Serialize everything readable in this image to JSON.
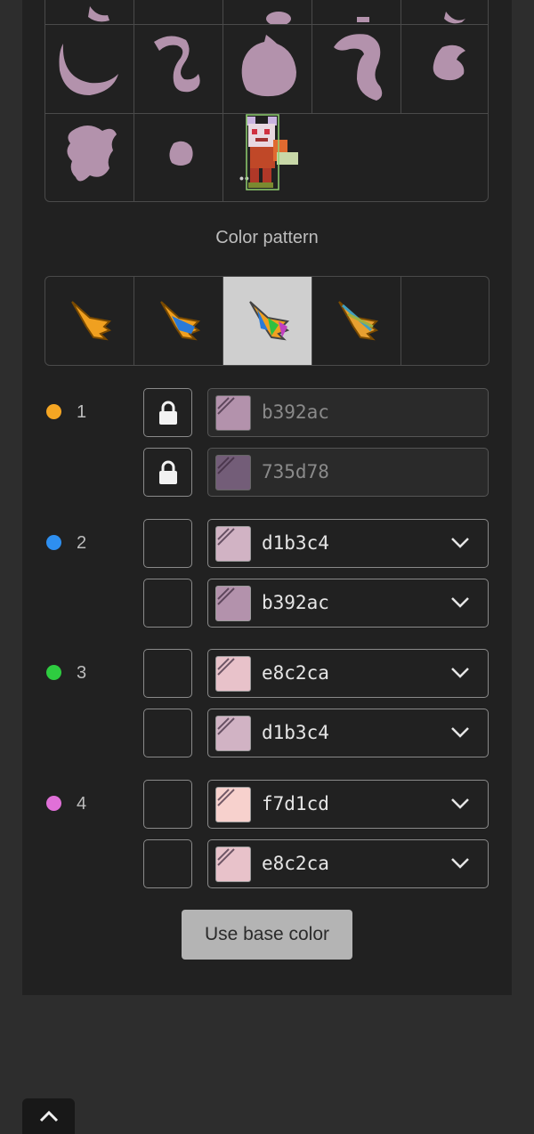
{
  "sprite_grid": {
    "more_label": "•••",
    "sprite_color": "#b392ac"
  },
  "color_pattern": {
    "title": "Color pattern",
    "options": [
      {
        "name": "pattern-1",
        "selected": false
      },
      {
        "name": "pattern-2",
        "selected": false
      },
      {
        "name": "pattern-3",
        "selected": true
      },
      {
        "name": "pattern-4",
        "selected": false
      },
      {
        "name": "pattern-5-empty",
        "selected": false
      }
    ]
  },
  "groups": [
    {
      "number": "1",
      "dot_color": "#f5a623",
      "rows": [
        {
          "hex": "b392ac",
          "color": "#b392ac",
          "locked": true
        },
        {
          "hex": "735d78",
          "color": "#735d78",
          "locked": true
        }
      ]
    },
    {
      "number": "2",
      "dot_color": "#2e8ff0",
      "rows": [
        {
          "hex": "d1b3c4",
          "color": "#d1b3c4",
          "locked": false
        },
        {
          "hex": "b392ac",
          "color": "#b392ac",
          "locked": false
        }
      ]
    },
    {
      "number": "3",
      "dot_color": "#2ecc40",
      "rows": [
        {
          "hex": "e8c2ca",
          "color": "#e8c2ca",
          "locked": false
        },
        {
          "hex": "d1b3c4",
          "color": "#d1b3c4",
          "locked": false
        }
      ]
    },
    {
      "number": "4",
      "dot_color": "#e070d8",
      "rows": [
        {
          "hex": "f7d1cd",
          "color": "#f7d1cd",
          "locked": false
        },
        {
          "hex": "e8c2ca",
          "color": "#e8c2ca",
          "locked": false
        }
      ]
    }
  ],
  "use_base_color_label": "Use base color",
  "icons": {
    "lock": "lock-icon",
    "chevron": "chevron-down-icon",
    "scroll_top": "chevron-up-icon"
  }
}
